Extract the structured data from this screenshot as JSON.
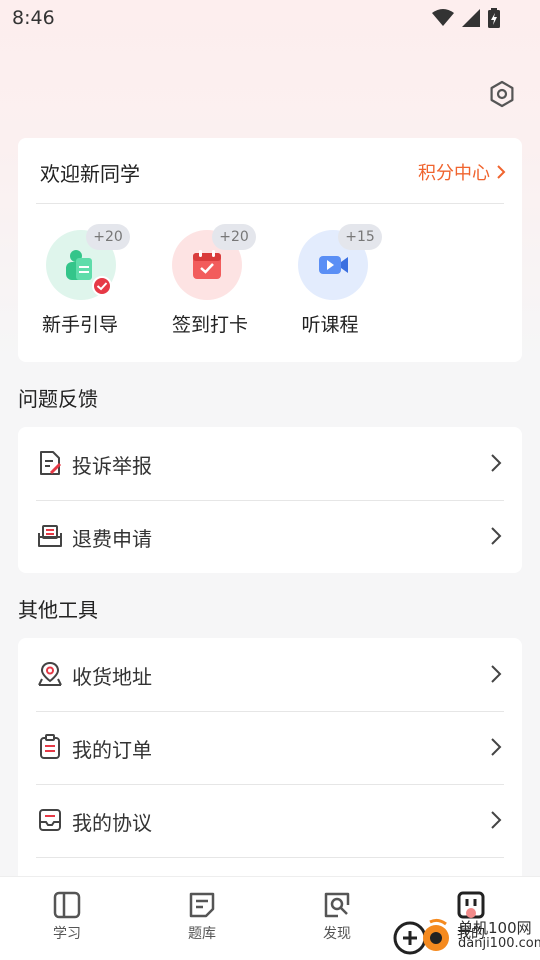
{
  "status_bar": {
    "time": "8:46"
  },
  "welcome": {
    "title": "欢迎新同学",
    "points_link": "积分中心"
  },
  "tasks": [
    {
      "label": "新手引导",
      "badge": "+20"
    },
    {
      "label": "签到打卡",
      "badge": "+20"
    },
    {
      "label": "听课程",
      "badge": "+15"
    }
  ],
  "feedback": {
    "title": "问题反馈",
    "items": [
      {
        "label": "投诉举报",
        "icon": "complaint-icon"
      },
      {
        "label": "退费申请",
        "icon": "refund-icon"
      }
    ]
  },
  "tools": {
    "title": "其他工具",
    "items": [
      {
        "label": "收货地址",
        "icon": "location-icon"
      },
      {
        "label": "我的订单",
        "icon": "order-icon"
      },
      {
        "label": "我的协议",
        "icon": "agreement-icon"
      }
    ]
  },
  "tab_bar": {
    "tabs": [
      {
        "label": "学习"
      },
      {
        "label": "题库"
      },
      {
        "label": "发现"
      },
      {
        "label": "我的"
      }
    ],
    "active": "我的"
  },
  "watermark": {
    "line1": "单机100网",
    "line2": "danji100.com"
  },
  "colors": {
    "accent": "#f0642e",
    "badge_bg": "#e4e6ec"
  }
}
